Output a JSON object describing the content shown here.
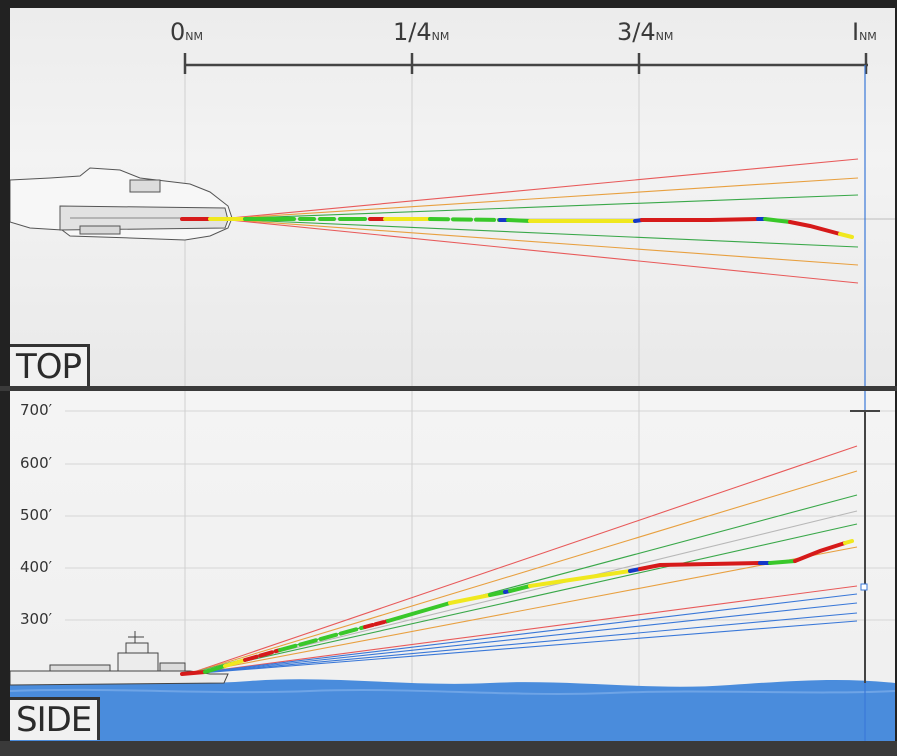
{
  "top_panel": {
    "label": "TOP",
    "scale": [
      {
        "value": "0",
        "unit": "NM"
      },
      {
        "value": "1/4",
        "unit": "NM"
      },
      {
        "value": "3/4",
        "unit": "NM"
      },
      {
        "value": "I",
        "unit": "NM"
      }
    ]
  },
  "side_panel": {
    "label": "SIDE",
    "altitudes": [
      "700′",
      "600′",
      "500′",
      "400′",
      "300′"
    ]
  },
  "colors": {
    "red": "#d61a1a",
    "yellow": "#f0e81e",
    "green": "#39c82a",
    "blue": "#1538c8",
    "guide_red": "#e85a5a",
    "guide_orange": "#e8a040",
    "guide_green": "#3aa84a",
    "guide_blue": "#3a78d8",
    "water": "#4a8cdc"
  }
}
